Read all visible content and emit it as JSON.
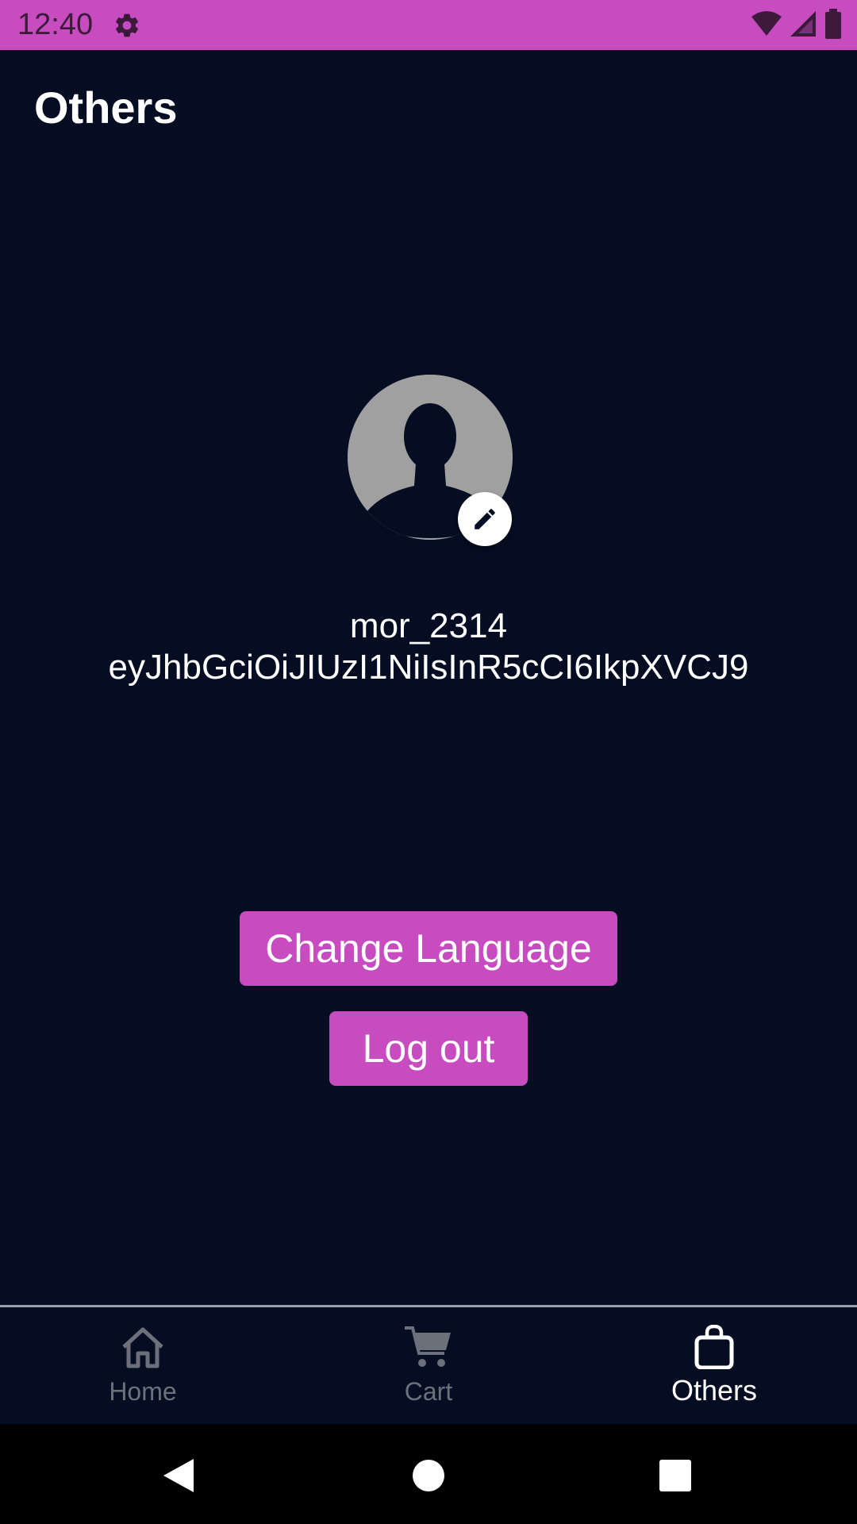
{
  "status_bar": {
    "time": "12:40",
    "icons": [
      "settings-gear-icon",
      "wifi-icon",
      "signal-icon",
      "battery-icon"
    ],
    "background": "#c64cc0"
  },
  "header": {
    "title": "Others"
  },
  "profile": {
    "username": "mor_2314",
    "token": "eyJhbGciOiJIUzI1NiIsInR5cCI6IkpXVCJ9",
    "avatar_icon": "person-silhouette-icon",
    "edit_icon": "pencil-icon"
  },
  "actions": {
    "change_language_label": "Change Language",
    "logout_label": "Log out",
    "accent": "#c64cc0"
  },
  "bottom_nav": {
    "items": [
      {
        "label": "Home",
        "icon": "home-icon",
        "active": false
      },
      {
        "label": "Cart",
        "icon": "cart-icon",
        "active": false
      },
      {
        "label": "Others",
        "icon": "shopping-bag-icon",
        "active": true
      }
    ]
  },
  "system_nav": {
    "icons": [
      "back-icon",
      "home-circle-icon",
      "recents-square-icon"
    ]
  },
  "colors": {
    "background": "#040d22",
    "inactive": "#6b707b",
    "active": "#ffffff"
  }
}
